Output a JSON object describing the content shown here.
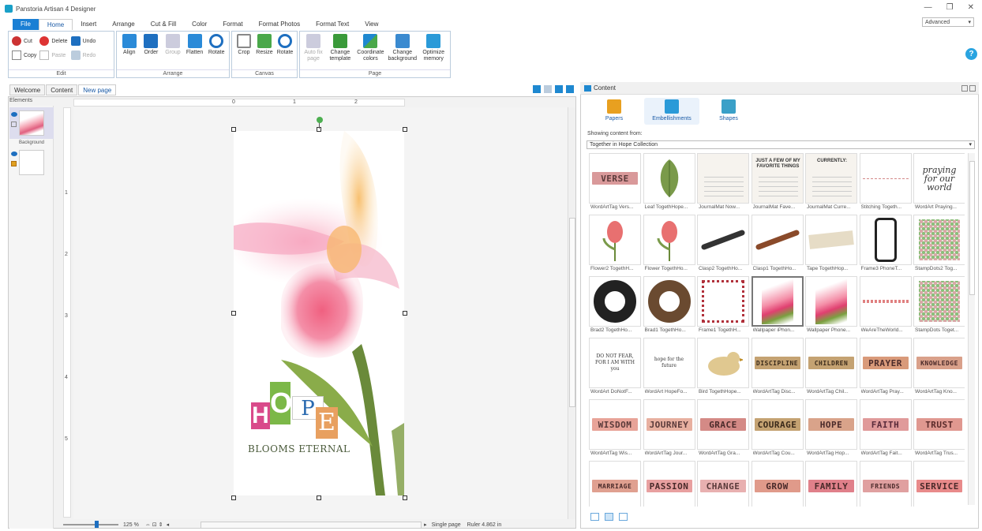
{
  "window": {
    "title": "Panstoria Artisan 4 Designer",
    "mode": "Advanced"
  },
  "menu": [
    "File",
    "Home",
    "Insert",
    "Arrange",
    "Cut & Fill",
    "Color",
    "Format",
    "Format Photos",
    "Format Text",
    "View"
  ],
  "ribbon": {
    "edit": {
      "label": "Edit",
      "cut": "Cut",
      "copy": "Copy",
      "delete": "Delete",
      "paste": "Paste",
      "undo": "Undo",
      "redo": "Redo"
    },
    "arrange": {
      "label": "Arrange",
      "align": "Align",
      "order": "Order",
      "group": "Group",
      "flatten": "Flatten",
      "rotate": "Rotate"
    },
    "canvas": {
      "label": "Canvas",
      "crop": "Crop",
      "resize": "Resize",
      "rotate": "Rotate"
    },
    "page": {
      "label": "Page",
      "auto_fix": "Auto fix",
      "auto_fix2": "page",
      "change_template": "Change",
      "change_template2": "template",
      "coordinate": "Coordinate",
      "coordinate2": "colors",
      "change_bg": "Change",
      "change_bg2": "background",
      "optimize": "Optimize",
      "optimize2": "memory"
    }
  },
  "doc_tabs": [
    "Welcome",
    "Content",
    "New page"
  ],
  "elements": {
    "label": "Elements",
    "background_caption": "Background"
  },
  "ruler": {
    "h": [
      "0",
      "1",
      "2"
    ],
    "v": [
      "1",
      "2",
      "3",
      "4",
      "5"
    ]
  },
  "page_art": {
    "hope": [
      "H",
      "O",
      "P",
      "E"
    ],
    "blooms": "BLOOMS ETERNAL"
  },
  "status": {
    "zoom": "125 %",
    "mode": "Single page",
    "ruler": "Ruler 4.862 in"
  },
  "content": {
    "title": "Content",
    "categories": [
      "Papers",
      "Embellishments",
      "Shapes"
    ],
    "showing_label": "Showing content from:",
    "collection": "Together in Hope Collection",
    "items": [
      {
        "label": "WordArtTag Vers...",
        "kind": "tag",
        "text": "VERSE",
        "bg": "#d9999a",
        "fg": "#5a3a3a"
      },
      {
        "label": "Leaf TogethHope...",
        "kind": "leaf"
      },
      {
        "label": "JournalMat Now...",
        "kind": "journal"
      },
      {
        "label": "JournalMat Fave...",
        "kind": "journal",
        "text": "JUST A FEW OF MY FAVORITE THINGS"
      },
      {
        "label": "JournalMat Curre...",
        "kind": "journal",
        "text": "CURRENTLY:"
      },
      {
        "label": "Stitching Togeth...",
        "kind": "stitch"
      },
      {
        "label": "WordArt Praying...",
        "kind": "script",
        "text": "praying for our world"
      },
      {
        "label": "Flower2 TogethH...",
        "kind": "flower"
      },
      {
        "label": "Flower TogethHo...",
        "kind": "flower"
      },
      {
        "label": "Clasp2 TogethHo...",
        "kind": "clasp"
      },
      {
        "label": "Clasp1 TogethHo...",
        "kind": "clasp2"
      },
      {
        "label": "Tape TogethHop...",
        "kind": "tape"
      },
      {
        "label": "Frame3 PhoneT...",
        "kind": "phone"
      },
      {
        "label": "StampDots2 Tog...",
        "kind": "dots"
      },
      {
        "label": "Brad2 TogethHo...",
        "kind": "brad"
      },
      {
        "label": "Brad1 TogethHo...",
        "kind": "brad2"
      },
      {
        "label": "Frame1 TogethH...",
        "kind": "frame"
      },
      {
        "label": "Wallpaper iPhon...",
        "kind": "wall",
        "selected": true
      },
      {
        "label": "Wallpaper Phone...",
        "kind": "wall"
      },
      {
        "label": "WeAreTheWorld...",
        "kind": "border"
      },
      {
        "label": "StampDots Toget...",
        "kind": "dots"
      },
      {
        "label": "WordArt DoNotF...",
        "kind": "words",
        "text": "DO NOT FEAR, FOR I AM WITH you"
      },
      {
        "label": "WordArt HopeFo...",
        "kind": "words",
        "text": "hope for the future"
      },
      {
        "label": "Bird TogethHope...",
        "kind": "bird"
      },
      {
        "label": "WordArtTag Disc...",
        "kind": "tag",
        "text": "DISCIPLINE",
        "bg": "#c4a272",
        "fg": "#3a2a1a",
        "small": true
      },
      {
        "label": "WordArtTag Chil...",
        "kind": "tag",
        "text": "CHILDREN",
        "bg": "#c4a272",
        "fg": "#3a2a1a",
        "small": true
      },
      {
        "label": "WordArtTag Pray...",
        "kind": "tag",
        "text": "PRAYER",
        "bg": "#d99a7a",
        "fg": "#4a2a2a"
      },
      {
        "label": "WordArtTag Kno...",
        "kind": "tag",
        "text": "KNOWLEDGE",
        "bg": "#d9a08a",
        "fg": "#4a2a2a",
        "small": true
      },
      {
        "label": "WordArtTag Wis...",
        "kind": "tag",
        "text": "WISDOM",
        "bg": "#e8a398",
        "fg": "#5a3a3a"
      },
      {
        "label": "WordArtTag Jour...",
        "kind": "tag",
        "text": "JOURNEY",
        "bg": "#e8b0a0",
        "fg": "#5a3a3a"
      },
      {
        "label": "WordArtTag Gra...",
        "kind": "tag",
        "text": "GRACE",
        "bg": "#d48a86",
        "fg": "#4a2a2a"
      },
      {
        "label": "WordArtTag Cou...",
        "kind": "tag",
        "text": "COURAGE",
        "bg": "#c4a272",
        "fg": "#3a2a1a"
      },
      {
        "label": "WordArtTag Hop...",
        "kind": "tag",
        "text": "HOPE",
        "bg": "#d9a38a",
        "fg": "#4a2a2a"
      },
      {
        "label": "WordArtTag Fait...",
        "kind": "tag",
        "text": "FAITH",
        "bg": "#e09a9a",
        "fg": "#5a2a3a"
      },
      {
        "label": "WordArtTag Trus...",
        "kind": "tag",
        "text": "TRUST",
        "bg": "#e09890",
        "fg": "#5a2a2a"
      },
      {
        "label": "",
        "kind": "tag",
        "text": "MARRIAGE",
        "bg": "#e0a090",
        "fg": "#4a2a2a",
        "small": true
      },
      {
        "label": "",
        "kind": "tag",
        "text": "PASSION",
        "bg": "#e8a0a0",
        "fg": "#4a2a2a"
      },
      {
        "label": "",
        "kind": "tag",
        "text": "CHANGE",
        "bg": "#e8b0b0",
        "fg": "#5a3a3a"
      },
      {
        "label": "",
        "kind": "tag",
        "text": "GROW",
        "bg": "#e09a8a",
        "fg": "#4a2a2a"
      },
      {
        "label": "",
        "kind": "tag",
        "text": "FAMILY",
        "bg": "#e0808a",
        "fg": "#4a2a2a"
      },
      {
        "label": "",
        "kind": "tag",
        "text": "FRIENDS",
        "bg": "#e0a0a0",
        "fg": "#4a2a2a",
        "small": true
      },
      {
        "label": "",
        "kind": "tag",
        "text": "SERVICE",
        "bg": "#e88a8a",
        "fg": "#4a2a2a"
      }
    ]
  },
  "colors": {
    "accent": "#1a7fd4",
    "help": "#2aa4e0"
  }
}
